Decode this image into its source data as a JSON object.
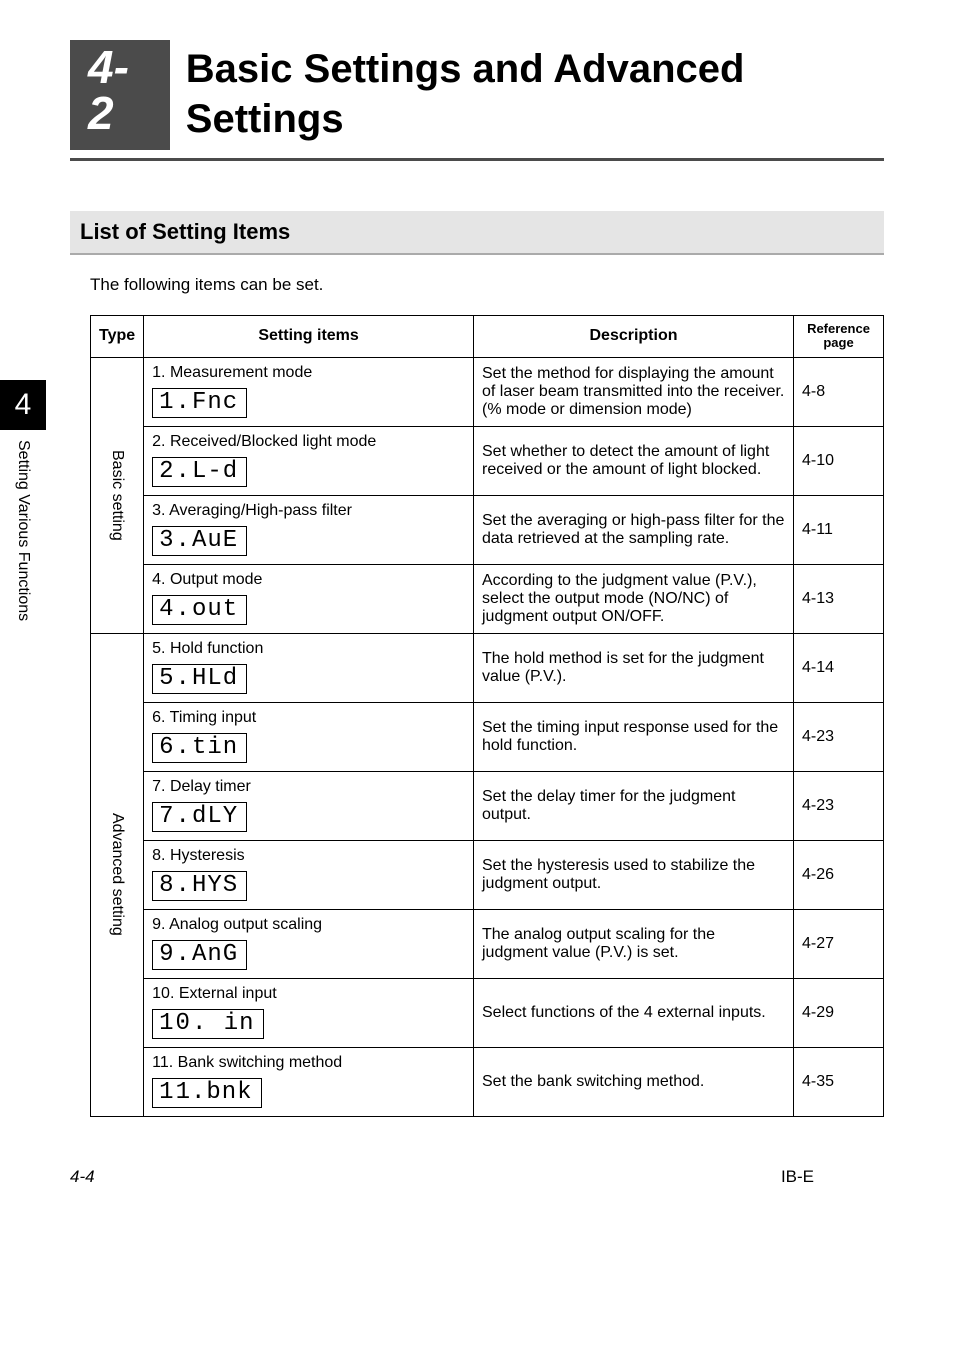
{
  "section": {
    "number": "4-2",
    "title": "Basic Settings and Advanced Settings"
  },
  "subsection_title": "List of Setting Items",
  "intro": "The following items can be set.",
  "side": {
    "chapter": "4",
    "caption": "Setting Various Functions"
  },
  "headers": {
    "type": "Type",
    "items": "Setting items",
    "desc": "Description",
    "ref": "Reference page"
  },
  "types": {
    "basic": "Basic setting",
    "advanced": "Advanced setting"
  },
  "rows": [
    {
      "name": "1. Measurement mode",
      "disp_lead": "1.",
      "disp_code": "Fnc",
      "desc": "Set the method for displaying the amount of laser beam transmitted into the receiver. (% mode or dimension mode)",
      "ref": "4-8"
    },
    {
      "name": "2. Received/Blocked light mode",
      "disp_lead": "2.",
      "disp_code": "L-d",
      "desc": "Set whether to detect the amount of light received or the amount of light blocked.",
      "ref": "4-10"
    },
    {
      "name": "3. Averaging/High-pass filter",
      "disp_lead": "3.",
      "disp_code": "AuE",
      "desc": "Set the averaging or high-pass filter for the data retrieved at the sampling rate.",
      "ref": "4-11"
    },
    {
      "name": "4. Output mode",
      "disp_lead": "4.",
      "disp_code": "out",
      "desc": "According to the judgment value (P.V.), select the output mode (NO/NC) of judgment output ON/OFF.",
      "ref": "4-13"
    },
    {
      "name": "5. Hold function",
      "disp_lead": "5.",
      "disp_code": "HLd",
      "desc": "The hold method is set for the judgment value (P.V.).",
      "ref": "4-14"
    },
    {
      "name": "6. Timing input",
      "disp_lead": "6.",
      "disp_code": "tin",
      "desc": "Set the timing input response used for the hold function.",
      "ref": "4-23"
    },
    {
      "name": "7. Delay timer",
      "disp_lead": "7.",
      "disp_code": "dLY",
      "desc": "Set the delay timer for the judgment output.",
      "ref": "4-23"
    },
    {
      "name": "8. Hysteresis",
      "disp_lead": "8.",
      "disp_code": "HYS",
      "desc": "Set the hysteresis used to stabilize the judgment output.",
      "ref": "4-26"
    },
    {
      "name": "9. Analog output scaling",
      "disp_lead": "9.",
      "disp_code": "AnG",
      "desc": "The analog output scaling for the judgment value (P.V.) is set.",
      "ref": "4-27"
    },
    {
      "name": "10. External input",
      "disp_lead": "10.",
      "disp_code": " in",
      "desc": "Select functions of the 4 external inputs.",
      "ref": "4-29"
    },
    {
      "name": "11. Bank switching method",
      "disp_lead": "1",
      "disp_code": "1.bnk",
      "desc": "Set the bank switching method.",
      "ref": "4-35"
    }
  ],
  "footer": {
    "left": "4-4",
    "right": "IB-E"
  }
}
